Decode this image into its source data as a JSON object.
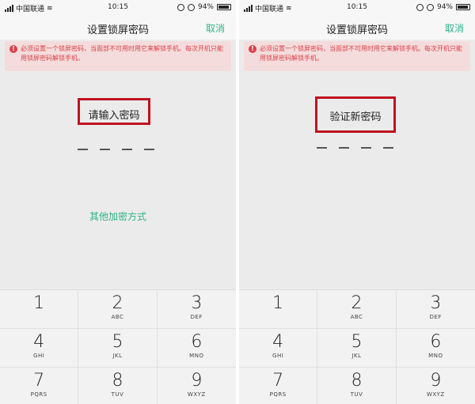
{
  "screens": [
    {
      "status": {
        "carrier": "中国联通",
        "time": "10:15",
        "battery": "94%"
      },
      "title": "设置锁屏密码",
      "cancel": "取消",
      "warning": "必须设置一个锁屏密码，当面部不可用时用它来解锁手机。每次开机只能用锁屏密码解锁手机。",
      "prompt": "请输入密码",
      "other_method": "其他加密方式",
      "keys": [
        {
          "digit": "1",
          "letters": ""
        },
        {
          "digit": "2",
          "letters": "ABC"
        },
        {
          "digit": "3",
          "letters": "DEF"
        },
        {
          "digit": "4",
          "letters": "GHI"
        },
        {
          "digit": "5",
          "letters": "JKL"
        },
        {
          "digit": "6",
          "letters": "MNO"
        },
        {
          "digit": "7",
          "letters": "PQRS"
        },
        {
          "digit": "8",
          "letters": "TUV"
        },
        {
          "digit": "9",
          "letters": "WXYZ"
        }
      ]
    },
    {
      "status": {
        "carrier": "中国联通",
        "time": "10:15",
        "battery": "94%"
      },
      "title": "设置锁屏密码",
      "cancel": "取消",
      "warning": "必须设置一个锁屏密码，当面部不可用时用它来解锁手机。每次开机只能用锁屏密码解锁手机。",
      "prompt": "验证新密码",
      "keys": [
        {
          "digit": "1",
          "letters": ""
        },
        {
          "digit": "2",
          "letters": "ABC"
        },
        {
          "digit": "3",
          "letters": "DEF"
        },
        {
          "digit": "4",
          "letters": "GHI"
        },
        {
          "digit": "5",
          "letters": "JKL"
        },
        {
          "digit": "6",
          "letters": "MNO"
        },
        {
          "digit": "7",
          "letters": "PQRS"
        },
        {
          "digit": "8",
          "letters": "TUV"
        },
        {
          "digit": "9",
          "letters": "WXYZ"
        }
      ]
    }
  ],
  "colors": {
    "accent": "#2fb389",
    "warning": "#d9424a",
    "highlight_box": "#c1121f"
  }
}
